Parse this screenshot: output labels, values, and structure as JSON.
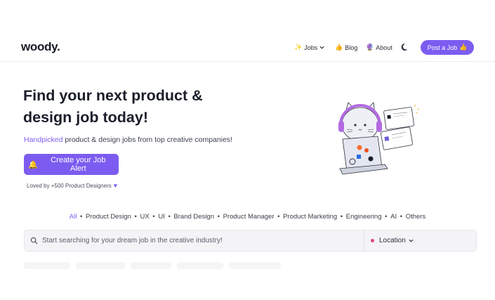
{
  "brand": {
    "logo": "woody."
  },
  "nav": {
    "jobs": {
      "emoji": "✨",
      "label": "Jobs"
    },
    "blog": {
      "emoji": "👍",
      "label": "Blog"
    },
    "about": {
      "emoji": "🔮",
      "label": "About"
    },
    "theme_icon": "moon-icon",
    "post_job": {
      "label": "Post a Job",
      "emoji": "👍"
    }
  },
  "hero": {
    "title": "Find your next product & design job today!",
    "subtitle_accent": "Handpicked",
    "subtitle_rest": " product & design jobs from top creative companies!",
    "cta_emoji": "🔔",
    "cta_label": "Create your Job Alert",
    "loved_by": "Loved by +500 Product Designers"
  },
  "categories": [
    "All",
    "Product Design",
    "UX",
    "UI",
    "Brand Design",
    "Product Manager",
    "Product Marketing",
    "Engineering",
    "AI",
    "Others"
  ],
  "search": {
    "placeholder": "Start searching for your dream job in the creative industry!",
    "location_label": "Location"
  },
  "colors": {
    "accent": "#7c5cf0",
    "text": "#1a1e2a",
    "location_dot": "#e0457b"
  }
}
